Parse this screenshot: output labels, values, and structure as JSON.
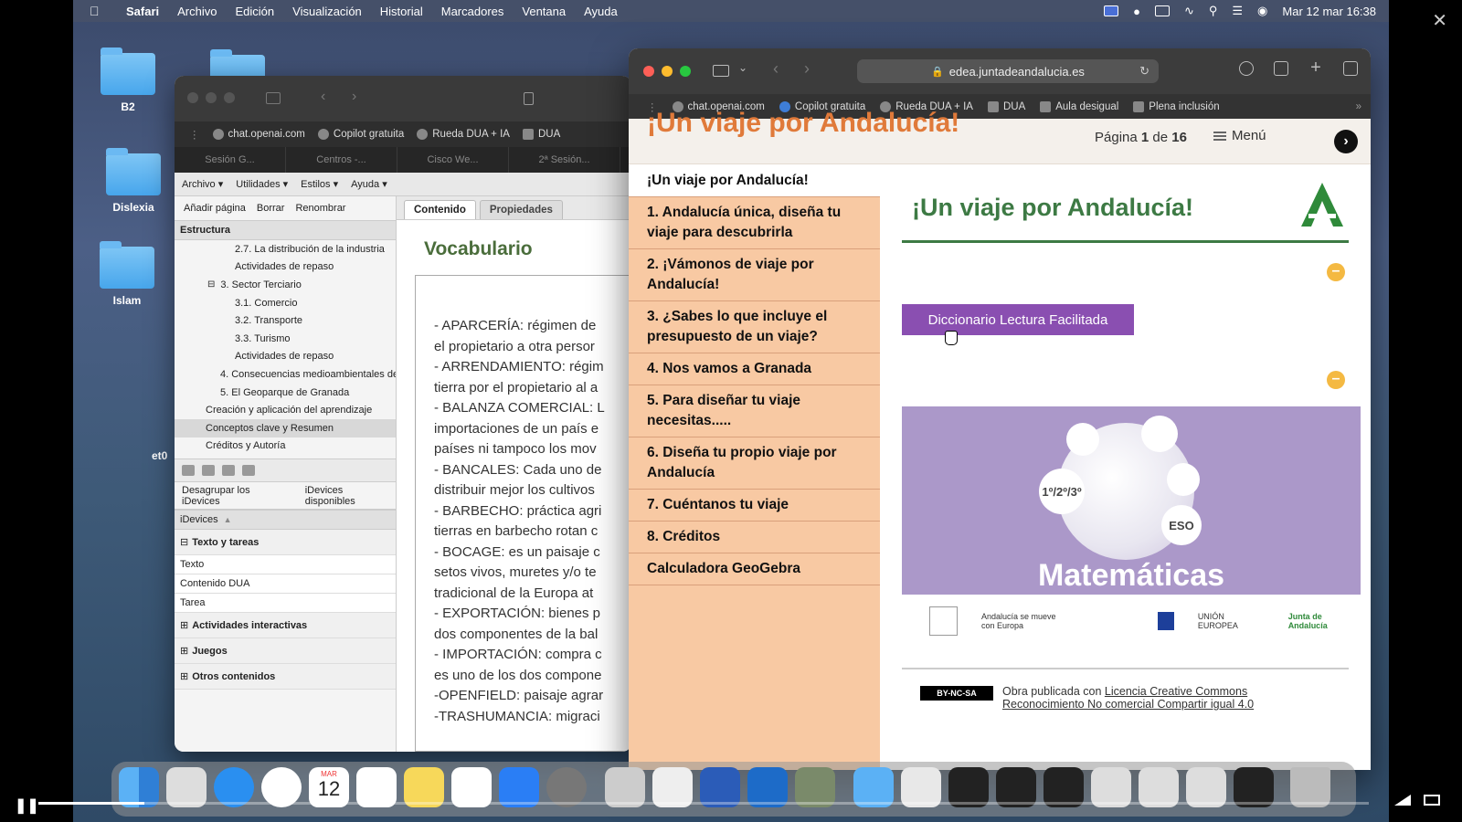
{
  "menubar": {
    "items": [
      "Safari",
      "Archivo",
      "Edición",
      "Visualización",
      "Historial",
      "Marcadores",
      "Ventana",
      "Ayuda"
    ],
    "datetime": "Mar 12 mar 16:38"
  },
  "desktop": {
    "icons": [
      "B2",
      "Dislexia",
      "Islam"
    ],
    "partial_text": "et0"
  },
  "back_window": {
    "bookmarks": [
      "chat.openai.com",
      "Copilot gratuita",
      "Rueda DUA + IA",
      "DUA"
    ],
    "tabs": [
      "Sesión G...",
      "Centros -...",
      "Cisco We...",
      "2ª Sesión..."
    ],
    "menu": [
      "Archivo ▾",
      "Utilidades ▾",
      "Estilos ▾",
      "Ayuda ▾"
    ],
    "tools": [
      "Añadir página",
      "Borrar",
      "Renombrar"
    ],
    "structure_title": "Estructura",
    "tree": [
      "2.7. La distribución de la industria",
      "Actividades de repaso",
      "3. Sector Terciario",
      "3.1. Comercio",
      "3.2. Transporte",
      "3.3. Turismo",
      "Actividades de repaso",
      "4. Consecuencias medioambientales de",
      "5. El Geoparque de Granada",
      "Creación y aplicación del aprendizaje",
      "Conceptos clave y Resumen",
      "Créditos y Autoría"
    ],
    "idevice_tabs": [
      "Desagrupar los iDevices",
      "iDevices disponibles"
    ],
    "idevices_head": "iDevices",
    "idevices": [
      "Texto y tareas",
      "Texto",
      "Contenido DUA",
      "Tarea",
      "Actividades interactivas",
      "Juegos",
      "Otros contenidos"
    ],
    "content_tabs": [
      "Contenido",
      "Propiedades"
    ],
    "vocab_title": "Vocabulario",
    "vocab_lines": [
      "- APARCERÍA: régimen de",
      "el propietario a otra persor",
      "- ARRENDAMIENTO: régim",
      "tierra por el propietario al a",
      "- BALANZA COMERCIAL: L",
      "importaciones de un país e",
      "países ni tampoco los mov",
      "- BANCALES: Cada uno de",
      "distribuir mejor los cultivos",
      "- BARBECHO: práctica agri",
      "tierras en barbecho rotan c",
      "- BOCAGE: es un paisaje c",
      "setos vivos, muretes y/o te",
      "tradicional de la Europa at",
      "- EXPORTACIÓN: bienes p",
      "dos componentes de la bal",
      "- IMPORTACIÓN: compra c",
      "es uno de los dos compone",
      "-OPENFIELD: paisaje agrar",
      "-TRASHUMANCIA: migraci"
    ]
  },
  "front_window": {
    "url": "edea.juntadeandalucia.es",
    "bookmarks": [
      "chat.openai.com",
      "Copilot gratuita",
      "Rueda DUA + IA",
      "DUA",
      "Aula desigual",
      "Plena inclusión"
    ],
    "header_title": "¡Un viaje por Andalucía!",
    "page_prefix": "Página",
    "page_current": "1",
    "page_mid": "de",
    "page_total": "16",
    "menu_label": "Menú",
    "nav": [
      "¡Un viaje por Andalucía!",
      "1. Andalucía única, diseña tu viaje para descubrirla",
      "2. ¡Vámonos de viaje por Andalucía!",
      "3. ¿Sabes lo que incluye el presupuesto de un viaje?",
      "4. Nos vamos a Granada",
      "5. Para diseñar tu viaje necesitas.....",
      "6. Diseña tu propio viaje por Andalucía",
      "7. Cuéntanos tu viaje",
      "8. Créditos",
      "Calculadora GeoGebra"
    ],
    "content_title": "¡Un viaje por Andalucía!",
    "dict_button": "Diccionario Lectura Facilitada",
    "banner": {
      "title": "Matemáticas",
      "bubble1": "1º/2º/3º",
      "bubble2": "ESO"
    },
    "logos": [
      "Andalucía se mueve con Europa",
      "UNIÓN EUROPEA",
      "Junta de Andalucía"
    ],
    "license_text": "Obra publicada con",
    "license_link1": "Licencia Creative Commons",
    "license_link2": "Reconocimiento No comercial Compartir igual 4.0",
    "cc_badge": "BY-NC-SA"
  },
  "dock": {
    "calendar_month": "MAR",
    "calendar_day": "12"
  },
  "video": {
    "progress": 0.08
  }
}
